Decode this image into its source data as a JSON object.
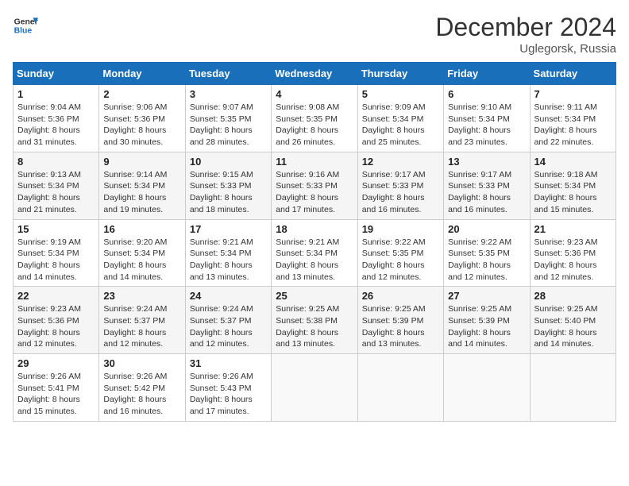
{
  "header": {
    "logo_general": "General",
    "logo_blue": "Blue",
    "month_title": "December 2024",
    "location": "Uglegorsk, Russia"
  },
  "weekdays": [
    "Sunday",
    "Monday",
    "Tuesday",
    "Wednesday",
    "Thursday",
    "Friday",
    "Saturday"
  ],
  "weeks": [
    [
      {
        "day": "1",
        "sunrise": "9:04 AM",
        "sunset": "5:36 PM",
        "daylight": "8 hours and 31 minutes."
      },
      {
        "day": "2",
        "sunrise": "9:06 AM",
        "sunset": "5:36 PM",
        "daylight": "8 hours and 30 minutes."
      },
      {
        "day": "3",
        "sunrise": "9:07 AM",
        "sunset": "5:35 PM",
        "daylight": "8 hours and 28 minutes."
      },
      {
        "day": "4",
        "sunrise": "9:08 AM",
        "sunset": "5:35 PM",
        "daylight": "8 hours and 26 minutes."
      },
      {
        "day": "5",
        "sunrise": "9:09 AM",
        "sunset": "5:34 PM",
        "daylight": "8 hours and 25 minutes."
      },
      {
        "day": "6",
        "sunrise": "9:10 AM",
        "sunset": "5:34 PM",
        "daylight": "8 hours and 23 minutes."
      },
      {
        "day": "7",
        "sunrise": "9:11 AM",
        "sunset": "5:34 PM",
        "daylight": "8 hours and 22 minutes."
      }
    ],
    [
      {
        "day": "8",
        "sunrise": "9:13 AM",
        "sunset": "5:34 PM",
        "daylight": "8 hours and 21 minutes."
      },
      {
        "day": "9",
        "sunrise": "9:14 AM",
        "sunset": "5:34 PM",
        "daylight": "8 hours and 19 minutes."
      },
      {
        "day": "10",
        "sunrise": "9:15 AM",
        "sunset": "5:33 PM",
        "daylight": "8 hours and 18 minutes."
      },
      {
        "day": "11",
        "sunrise": "9:16 AM",
        "sunset": "5:33 PM",
        "daylight": "8 hours and 17 minutes."
      },
      {
        "day": "12",
        "sunrise": "9:17 AM",
        "sunset": "5:33 PM",
        "daylight": "8 hours and 16 minutes."
      },
      {
        "day": "13",
        "sunrise": "9:17 AM",
        "sunset": "5:33 PM",
        "daylight": "8 hours and 16 minutes."
      },
      {
        "day": "14",
        "sunrise": "9:18 AM",
        "sunset": "5:34 PM",
        "daylight": "8 hours and 15 minutes."
      }
    ],
    [
      {
        "day": "15",
        "sunrise": "9:19 AM",
        "sunset": "5:34 PM",
        "daylight": "8 hours and 14 minutes."
      },
      {
        "day": "16",
        "sunrise": "9:20 AM",
        "sunset": "5:34 PM",
        "daylight": "8 hours and 14 minutes."
      },
      {
        "day": "17",
        "sunrise": "9:21 AM",
        "sunset": "5:34 PM",
        "daylight": "8 hours and 13 minutes."
      },
      {
        "day": "18",
        "sunrise": "9:21 AM",
        "sunset": "5:34 PM",
        "daylight": "8 hours and 13 minutes."
      },
      {
        "day": "19",
        "sunrise": "9:22 AM",
        "sunset": "5:35 PM",
        "daylight": "8 hours and 12 minutes."
      },
      {
        "day": "20",
        "sunrise": "9:22 AM",
        "sunset": "5:35 PM",
        "daylight": "8 hours and 12 minutes."
      },
      {
        "day": "21",
        "sunrise": "9:23 AM",
        "sunset": "5:36 PM",
        "daylight": "8 hours and 12 minutes."
      }
    ],
    [
      {
        "day": "22",
        "sunrise": "9:23 AM",
        "sunset": "5:36 PM",
        "daylight": "8 hours and 12 minutes."
      },
      {
        "day": "23",
        "sunrise": "9:24 AM",
        "sunset": "5:37 PM",
        "daylight": "8 hours and 12 minutes."
      },
      {
        "day": "24",
        "sunrise": "9:24 AM",
        "sunset": "5:37 PM",
        "daylight": "8 hours and 12 minutes."
      },
      {
        "day": "25",
        "sunrise": "9:25 AM",
        "sunset": "5:38 PM",
        "daylight": "8 hours and 13 minutes."
      },
      {
        "day": "26",
        "sunrise": "9:25 AM",
        "sunset": "5:39 PM",
        "daylight": "8 hours and 13 minutes."
      },
      {
        "day": "27",
        "sunrise": "9:25 AM",
        "sunset": "5:39 PM",
        "daylight": "8 hours and 14 minutes."
      },
      {
        "day": "28",
        "sunrise": "9:25 AM",
        "sunset": "5:40 PM",
        "daylight": "8 hours and 14 minutes."
      }
    ],
    [
      {
        "day": "29",
        "sunrise": "9:26 AM",
        "sunset": "5:41 PM",
        "daylight": "8 hours and 15 minutes."
      },
      {
        "day": "30",
        "sunrise": "9:26 AM",
        "sunset": "5:42 PM",
        "daylight": "8 hours and 16 minutes."
      },
      {
        "day": "31",
        "sunrise": "9:26 AM",
        "sunset": "5:43 PM",
        "daylight": "8 hours and 17 minutes."
      },
      null,
      null,
      null,
      null
    ]
  ],
  "labels": {
    "sunrise": "Sunrise:",
    "sunset": "Sunset:",
    "daylight": "Daylight:"
  }
}
